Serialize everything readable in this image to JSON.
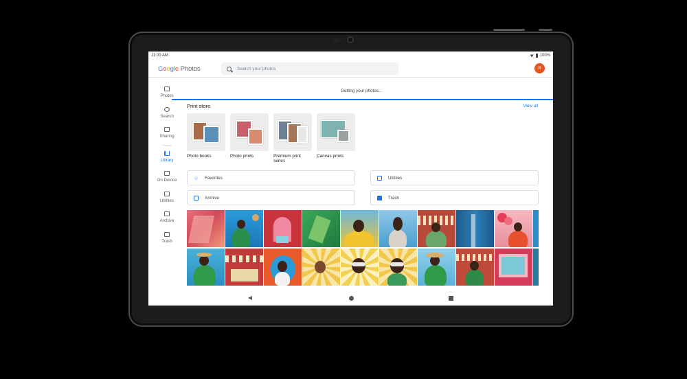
{
  "status": {
    "time": "11:00 AM",
    "battery": "100%"
  },
  "app": {
    "logo": [
      "G",
      "o",
      "o",
      "g",
      "l",
      "e"
    ],
    "logo_suffix": "Photos",
    "avatar_letter": "R"
  },
  "search": {
    "placeholder": "Search your photos"
  },
  "nav": {
    "items": [
      {
        "label": "Photos",
        "icon": "photo-icon"
      },
      {
        "label": "Search",
        "icon": "search-icon"
      },
      {
        "label": "Sharing",
        "icon": "chat-icon"
      },
      {
        "label": "Library",
        "icon": "library-icon",
        "active": true
      },
      {
        "label": "On Device",
        "icon": "folder-icon"
      },
      {
        "label": "Utilities",
        "icon": "utilities-icon"
      },
      {
        "label": "Archive",
        "icon": "archive-icon"
      },
      {
        "label": "Trash",
        "icon": "trash-icon"
      }
    ]
  },
  "loading": {
    "text": "Getting your photos..."
  },
  "print_store": {
    "title": "Print store",
    "view_all": "View all",
    "cards": [
      {
        "label": "Photo books"
      },
      {
        "label": "Photo prints"
      },
      {
        "label": "Premium print series"
      },
      {
        "label": "Canvas prints"
      }
    ]
  },
  "library_buttons": {
    "favorites": "Favorites",
    "utilities": "Utilities",
    "archive": "Archive",
    "trash": "Trash"
  },
  "colors": {
    "accent": "#1a73e8",
    "avatar": "#e8541e"
  }
}
